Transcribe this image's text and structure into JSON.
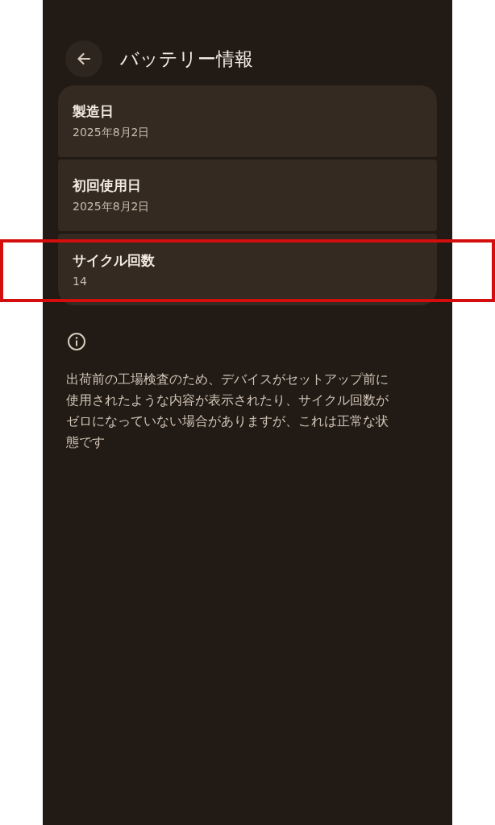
{
  "header": {
    "title": "バッテリー情報"
  },
  "cards": [
    {
      "label": "製造日",
      "value": "2025年8月2日",
      "highlighted": false
    },
    {
      "label": "初回使用日",
      "value": "2025年8月2日",
      "highlighted": false
    },
    {
      "label": "サイクル回数",
      "value": "14",
      "highlighted": true
    }
  ],
  "note": {
    "text": "出荷前の工場検査のため、デバイスがセットアップ前に使用されたような内容が表示されたり、サイクル回数がゼロになっていない場合がありますが、これは正常な状態です"
  }
}
